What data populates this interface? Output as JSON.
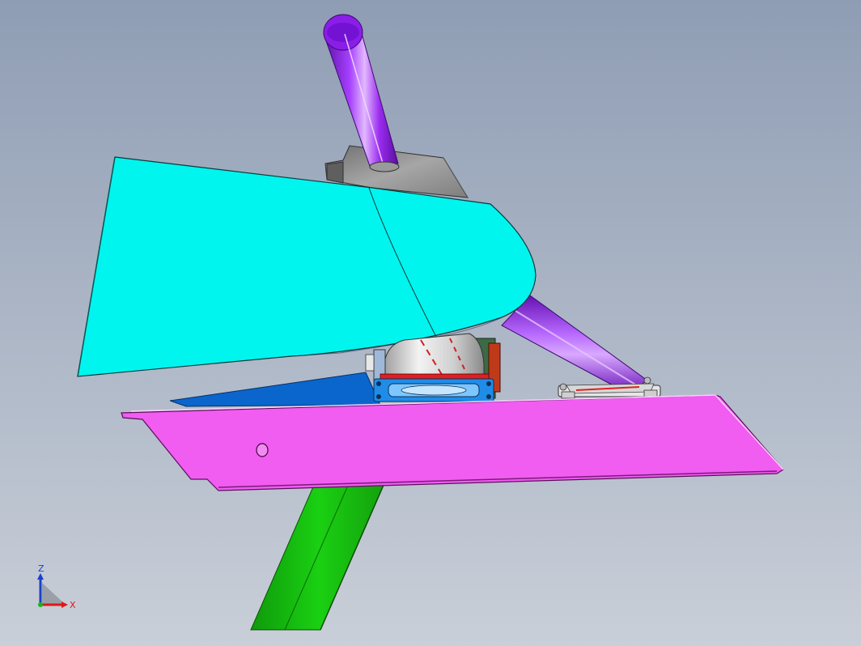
{
  "viewport": {
    "background_top": "#8f9db4",
    "background_bottom": "#c9cfd8"
  },
  "model": {
    "parts": [
      {
        "name": "purple-tube",
        "color": "#9a2bf0"
      },
      {
        "name": "cyan-hood",
        "color": "#00f5f0"
      },
      {
        "name": "magenta-plate",
        "color": "#f15cf1"
      },
      {
        "name": "green-beam",
        "color": "#17c20f"
      },
      {
        "name": "blue-plate",
        "color": "#0a66cc"
      },
      {
        "name": "gray-bracket",
        "color": "#8e8e8e"
      },
      {
        "name": "fan-assembly",
        "color": "#2196f3"
      }
    ]
  },
  "triad": {
    "z_label": "Z",
    "x_label": "X",
    "z_color": "#1a3fd0",
    "x_color": "#e01818",
    "y_color": "#9aa0a8"
  }
}
